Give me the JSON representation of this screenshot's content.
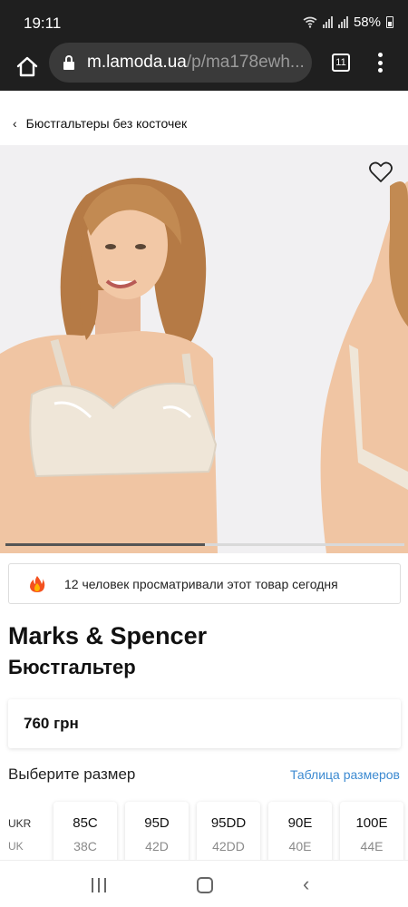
{
  "status_bar": {
    "time": "19:11",
    "battery": "58%"
  },
  "browser": {
    "url_host": "m.lamoda.ua",
    "url_path": "/p/ma178ewh...",
    "tab_count": "11"
  },
  "breadcrumb": {
    "back_icon": "chevron-left-icon",
    "label": "Бюстгальтеры без косточек"
  },
  "gallery": {
    "wishlist_icon": "heart-icon",
    "progress": 0.5
  },
  "viewers": {
    "icon": "fire-icon",
    "text": "12 человек просматривали этот товар сегодня"
  },
  "product": {
    "brand": "Marks & Spencer",
    "name": "Бюстгальтер",
    "price": "760 грн"
  },
  "sizes": {
    "title": "Выберите размер",
    "chart_link": "Таблица размеров",
    "row_labels": [
      "UKR",
      "UK"
    ],
    "items": [
      {
        "main": "85C",
        "alt": "38C"
      },
      {
        "main": "95D",
        "alt": "42D"
      },
      {
        "main": "95DD",
        "alt": "42DD"
      },
      {
        "main": "90E",
        "alt": "40E"
      },
      {
        "main": "100E",
        "alt": "44E"
      }
    ]
  },
  "colors": {
    "link": "#3c8ad1",
    "topbar": "#1f1f1f",
    "skin": "#f0c5a3",
    "bra": "#efe6d8"
  }
}
